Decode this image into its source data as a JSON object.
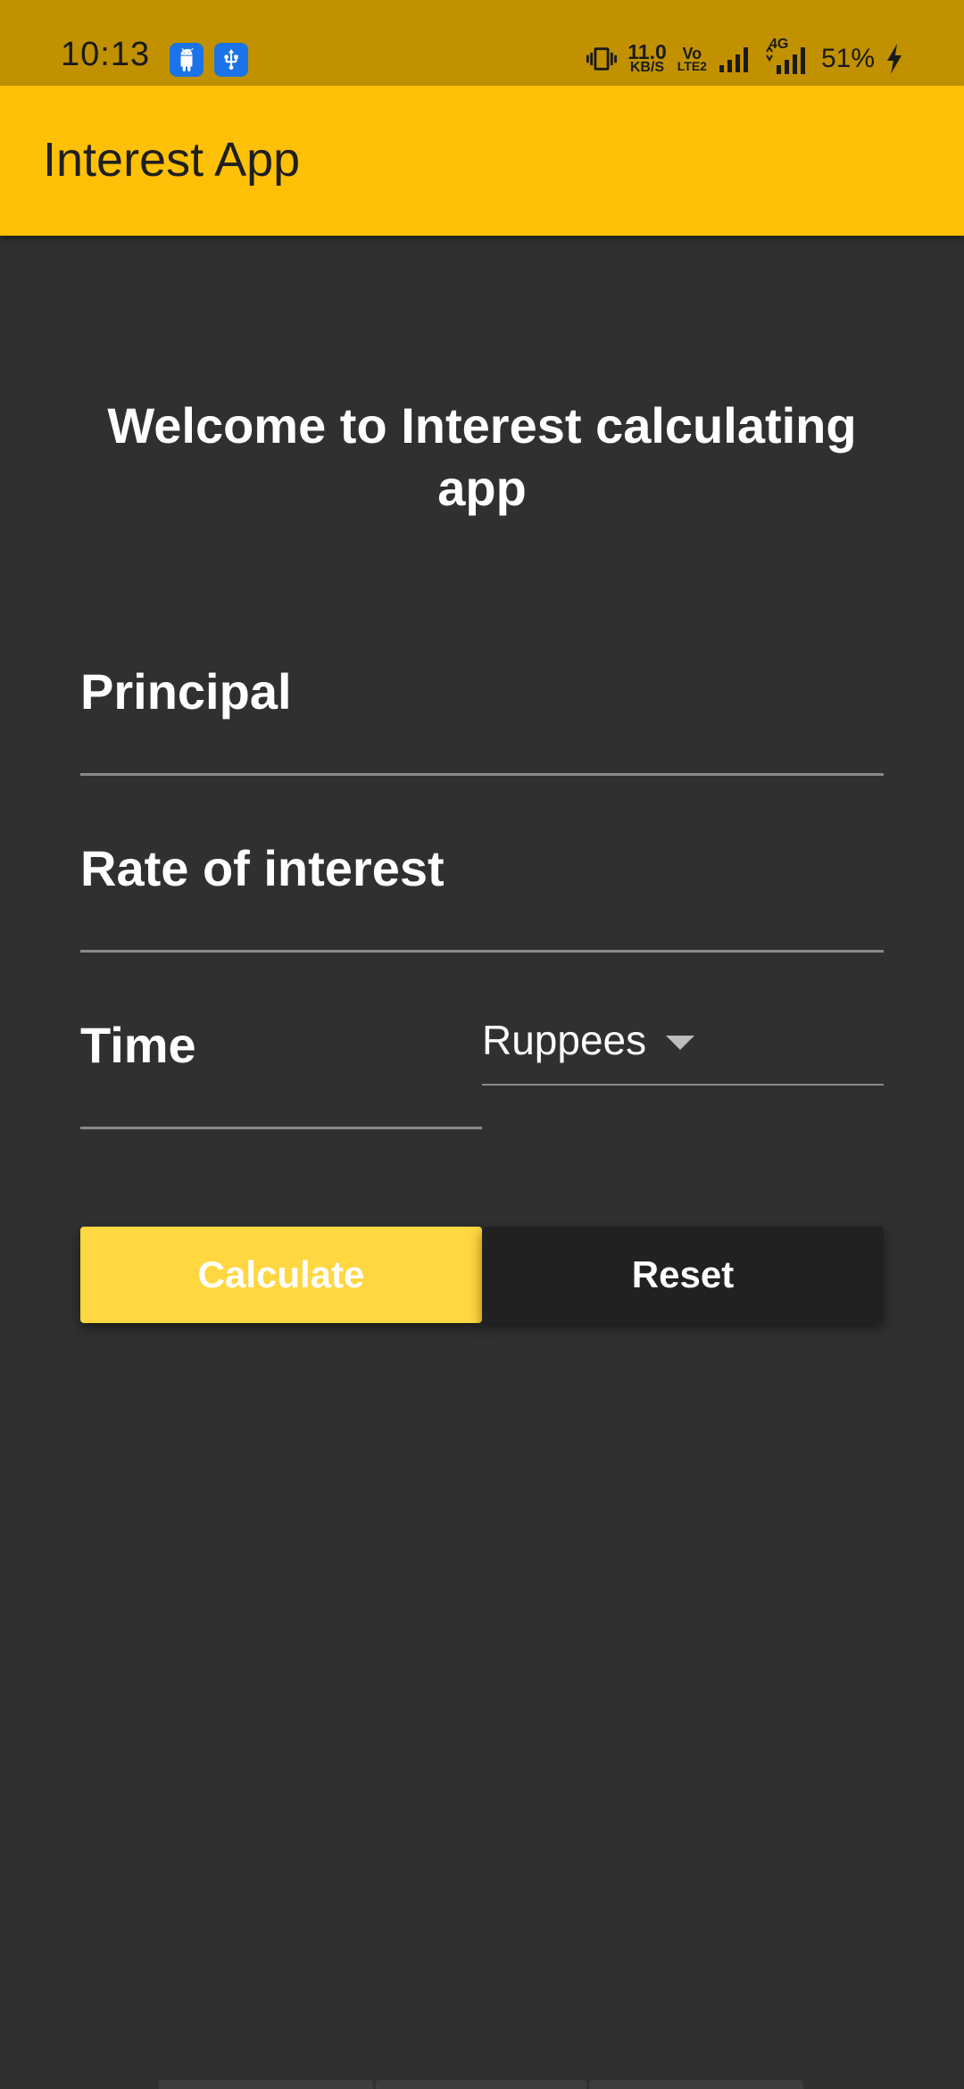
{
  "status_bar": {
    "time": "10:13",
    "notification_icons": [
      "android-icon",
      "usb-icon"
    ],
    "net_speed_value": "11.0",
    "net_speed_unit": "KB/S",
    "volte_top": "Vo",
    "volte_bottom": "LTE2",
    "network_type": "4G",
    "battery_percent": "51%",
    "charging": true
  },
  "app_bar": {
    "title": "Interest App",
    "color": "#FFC107"
  },
  "main": {
    "welcome_text": "Welcome to Interest calculating app",
    "principal_placeholder": "Principal",
    "rate_placeholder": "Rate of interest",
    "time_placeholder": "Time",
    "currency_dropdown": {
      "selected": "Ruppees"
    },
    "calculate_label": "Calculate",
    "reset_label": "Reset"
  },
  "colors": {
    "background": "#303030",
    "accent": "#FFD740",
    "status_bar": "#C19100"
  }
}
